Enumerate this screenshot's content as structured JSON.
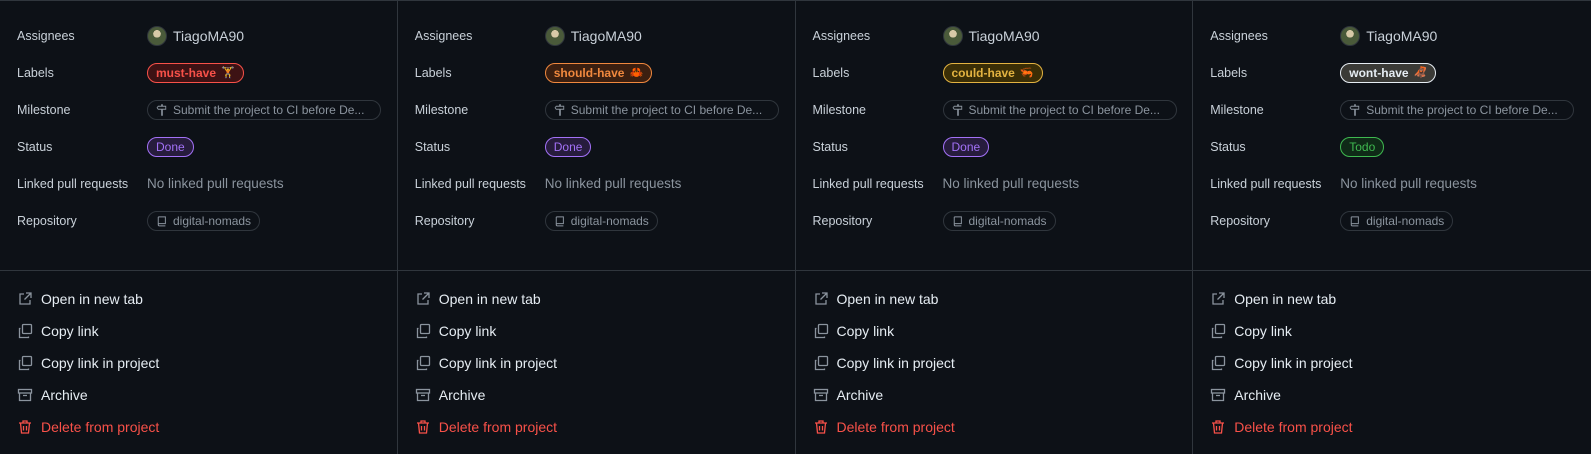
{
  "field_labels": {
    "assignees": "Assignees",
    "labels": "Labels",
    "milestone": "Milestone",
    "status": "Status",
    "linked_prs": "Linked pull requests",
    "repository": "Repository"
  },
  "menu": {
    "open_new_tab": "Open in new tab",
    "copy_link": "Copy link",
    "copy_link_project": "Copy link in project",
    "archive": "Archive",
    "delete": "Delete from project"
  },
  "icons": {
    "open": "external-link-icon",
    "copy": "copy-icon",
    "archive": "archive-icon",
    "delete": "trash-icon",
    "milestone": "milestone-icon",
    "repo": "repo-icon"
  },
  "cards": [
    {
      "assignee": "TiagoMA90",
      "label": {
        "text": "must-have",
        "emoji": "🏋",
        "color": "#f85149",
        "bg": "#3d1214"
      },
      "milestone": "Submit the project to CI before De...",
      "status": {
        "text": "Done",
        "color": "#a371f7",
        "bg": "#271c3d"
      },
      "linked_prs": "No linked pull requests",
      "repository": "digital-nomads"
    },
    {
      "assignee": "TiagoMA90",
      "label": {
        "text": "should-have",
        "emoji": "🦀",
        "color": "#f0883e",
        "bg": "#3b1f10"
      },
      "milestone": "Submit the project to CI before De...",
      "status": {
        "text": "Done",
        "color": "#a371f7",
        "bg": "#271c3d"
      },
      "linked_prs": "No linked pull requests",
      "repository": "digital-nomads"
    },
    {
      "assignee": "TiagoMA90",
      "label": {
        "text": "could-have",
        "emoji": "🦐",
        "color": "#e3b341",
        "bg": "#3a2e06"
      },
      "milestone": "Submit the project to CI before De...",
      "status": {
        "text": "Done",
        "color": "#a371f7",
        "bg": "#271c3d"
      },
      "linked_prs": "No linked pull requests",
      "repository": "digital-nomads"
    },
    {
      "assignee": "TiagoMA90",
      "label": {
        "text": "wont-have",
        "emoji": "🦧",
        "color": "#e6edf3",
        "bg": "#3a3a36"
      },
      "milestone": "Submit the project to CI before De...",
      "status": {
        "text": "Todo",
        "color": "#3fb950",
        "bg": "#0f2a17"
      },
      "linked_prs": "No linked pull requests",
      "repository": "digital-nomads"
    }
  ]
}
